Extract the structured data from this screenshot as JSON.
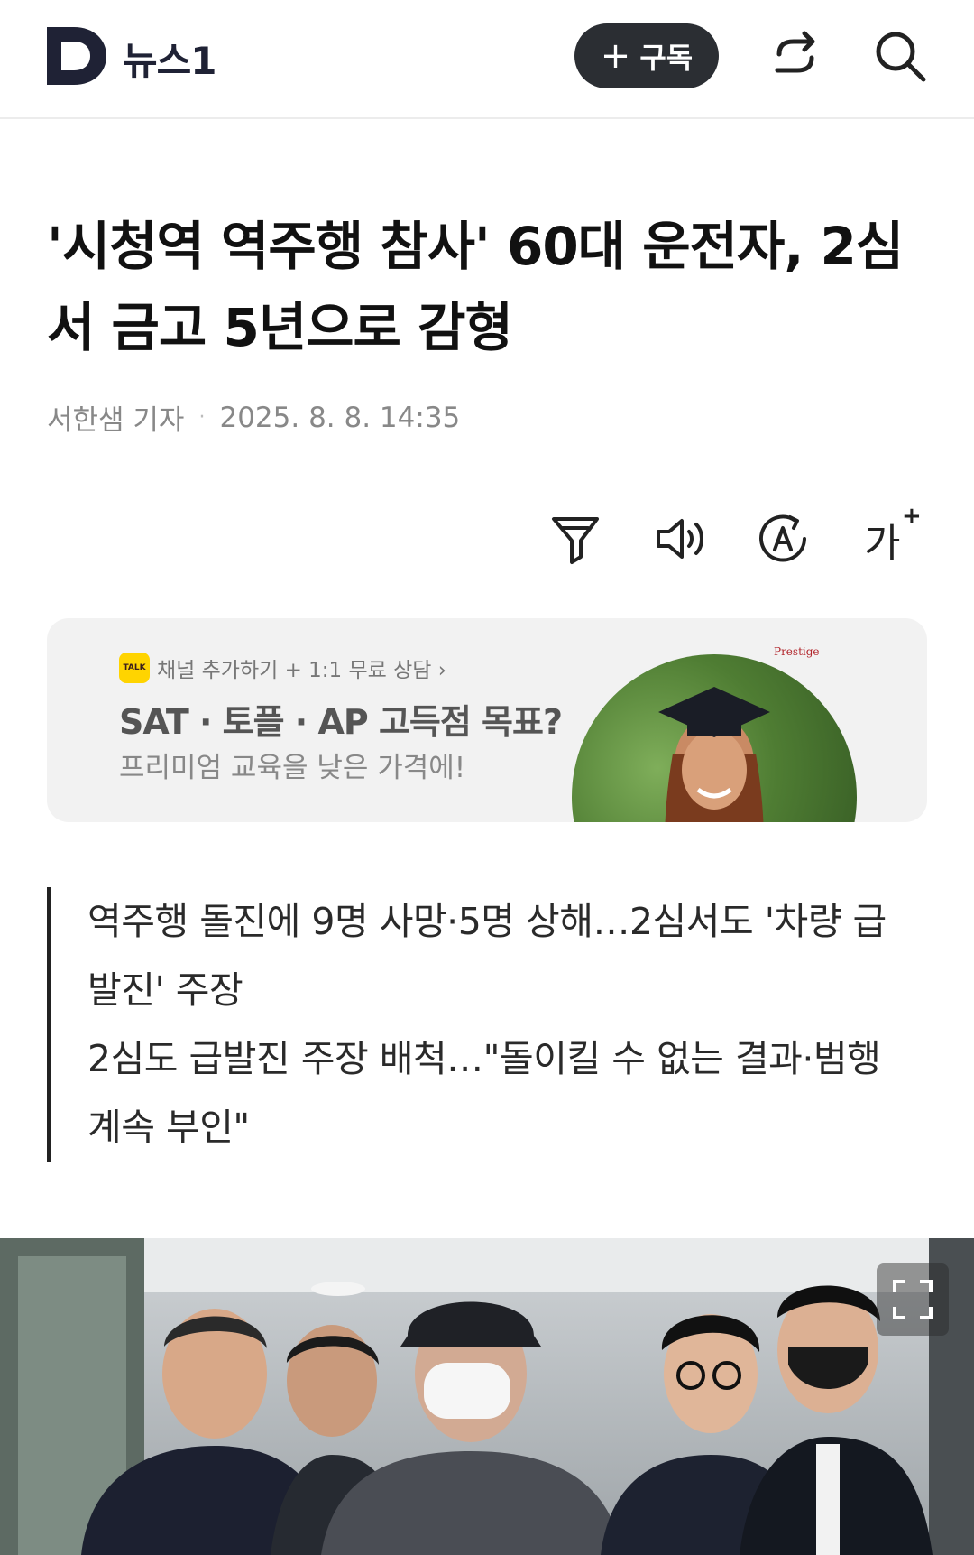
{
  "header": {
    "logo_text": "뉴스1",
    "subscribe_label": "구독",
    "subscribe_plus": "+",
    "icons": [
      "share-icon",
      "search-icon"
    ]
  },
  "article": {
    "title": "'시청역 역주행 참사' 60대 운전자, 2심서 금고 5년으로 감형",
    "reporter": "서한샘 기자",
    "separator": "·",
    "date": "2025. 8. 8. 14:35"
  },
  "tools": {
    "icons": [
      "filter-icon",
      "audio-icon",
      "translate-icon",
      "font-size-icon"
    ],
    "font_size_label": "가",
    "font_size_plus": "+"
  },
  "ad": {
    "talk_badge": "TALK",
    "channel_text": "채널 추가하기 + 1:1 무료 상담 ›",
    "headline": "SAT · 토플 · AP 고득점 목표?",
    "subtext": "프리미엄 교육을 낮은 가격에!",
    "brand": "Prestige"
  },
  "summary": {
    "lines": [
      "역주행 돌진에 9명 사망·5명 상해…2심서도 '차량 급발진' 주장",
      "2심도 급발진 주장 배척…\"돌이킬 수 없는 결과·범행 계속 부인\""
    ]
  },
  "colors": {
    "logo_navy": "#1f2235",
    "subscribe_bg": "#2b2e33",
    "kakao_yellow": "#ffd400"
  }
}
